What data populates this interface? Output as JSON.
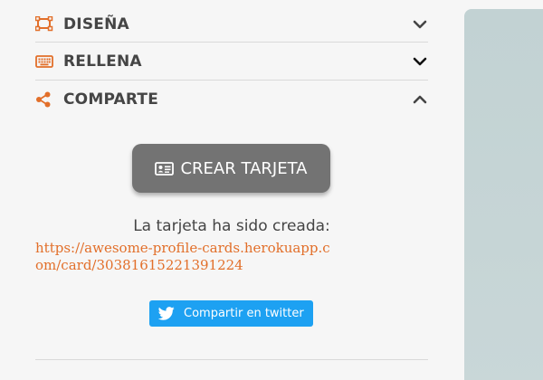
{
  "accordion": {
    "design": {
      "label": "DISEÑA",
      "icon": "design-icon",
      "state": "collapsed"
    },
    "fill": {
      "label": "RELLENA",
      "icon": "keyboard-icon",
      "state": "collapsed"
    },
    "share": {
      "label": "COMPARTE",
      "icon": "share-icon",
      "state": "expanded"
    }
  },
  "share_section": {
    "create_button_label": "CREAR TARJETA",
    "created_message": "La tarjeta ha sido creada:",
    "card_url": "https://awesome-profile-cards.herokuapp.com/card/30381615221391224",
    "twitter_button_label": "Compartir en twitter"
  },
  "colors": {
    "accent": "#e26f2a",
    "heading_text": "#454545",
    "create_button_bg": "#737373",
    "twitter_blue": "#1da1f2",
    "preview_bg": "#c2d2d3"
  }
}
